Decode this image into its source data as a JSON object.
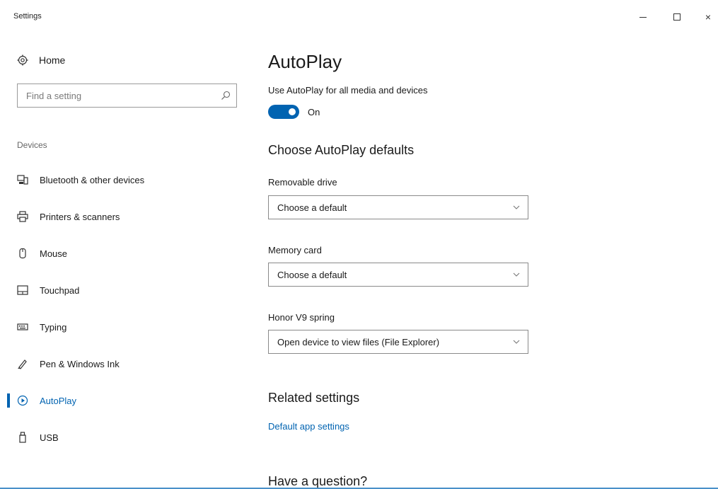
{
  "window": {
    "title": "Settings",
    "minimize_label": "",
    "maximize_label": "",
    "close_label": "×"
  },
  "sidebar": {
    "home_label": "Home",
    "search_placeholder": "Find a setting",
    "section_label": "Devices",
    "items": [
      {
        "label": "Bluetooth & other devices",
        "icon": "bluetooth-devices-icon",
        "active": false
      },
      {
        "label": "Printers & scanners",
        "icon": "printer-icon",
        "active": false
      },
      {
        "label": "Mouse",
        "icon": "mouse-icon",
        "active": false
      },
      {
        "label": "Touchpad",
        "icon": "touchpad-icon",
        "active": false
      },
      {
        "label": "Typing",
        "icon": "keyboard-icon",
        "active": false
      },
      {
        "label": "Pen & Windows Ink",
        "icon": "pen-icon",
        "active": false
      },
      {
        "label": "AutoPlay",
        "icon": "autoplay-icon",
        "active": true
      },
      {
        "label": "USB",
        "icon": "usb-icon",
        "active": false
      }
    ]
  },
  "main": {
    "title": "AutoPlay",
    "toggle": {
      "label": "Use AutoPlay for all media and devices",
      "state_label": "On",
      "on": true
    },
    "defaults_heading": "Choose AutoPlay defaults",
    "fields": [
      {
        "label": "Removable drive",
        "value": "Choose a default"
      },
      {
        "label": "Memory card",
        "value": "Choose a default"
      },
      {
        "label": "Honor V9 spring",
        "value": "Open device to view files (File Explorer)"
      }
    ],
    "related_heading": "Related settings",
    "related_link": "Default app settings",
    "question_heading": "Have a question?"
  },
  "colors": {
    "accent": "#0063b1",
    "background": "#ffffff",
    "border": "#8a8a8a"
  }
}
